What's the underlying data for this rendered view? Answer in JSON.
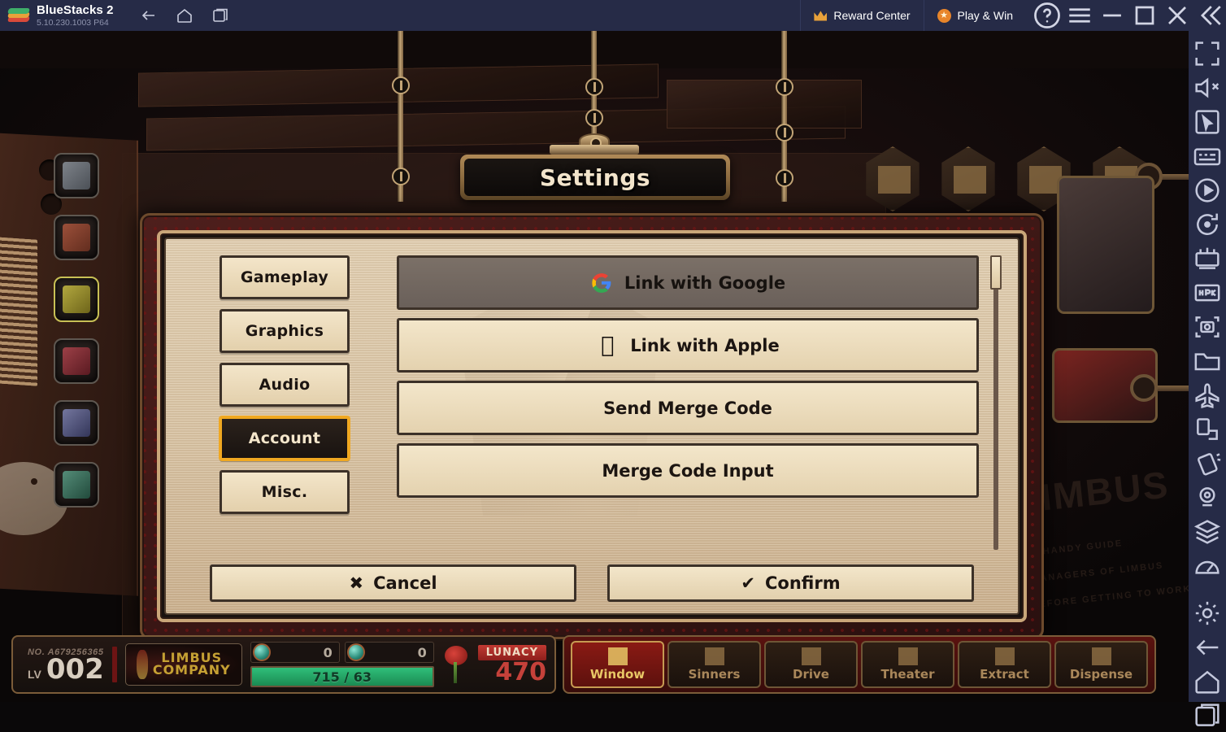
{
  "titlebar": {
    "app_name": "BlueStacks 2",
    "version": "5.10.230.1003  P64",
    "logo_icon": "bluestacks-logo-icon",
    "nav": [
      {
        "name": "back-button",
        "icon": "arrow-left-icon"
      },
      {
        "name": "home-button",
        "icon": "home-icon"
      },
      {
        "name": "recents-button",
        "icon": "multi-window-icon"
      }
    ],
    "reward_center_label": "Reward Center",
    "reward_center_icon": "crown-icon",
    "play_and_win_label": "Play & Win",
    "play_and_win_icon": "star-badge-icon",
    "sys_buttons": [
      {
        "name": "help-button",
        "icon": "question-circle-icon"
      },
      {
        "name": "menu-button",
        "icon": "hamburger-icon"
      },
      {
        "name": "minimize-button",
        "icon": "minimize-icon"
      },
      {
        "name": "maximize-button",
        "icon": "maximize-icon"
      },
      {
        "name": "close-button",
        "icon": "close-icon"
      },
      {
        "name": "collapse-sidebar-button",
        "icon": "double-chevron-left-icon"
      }
    ]
  },
  "right_toolbar": {
    "items": [
      {
        "name": "fullscreen-button",
        "icon": "fullscreen-icon"
      },
      {
        "name": "mute-button",
        "icon": "speaker-mute-icon"
      },
      {
        "name": "cursor-mode-button",
        "icon": "cursor-pointer-icon"
      },
      {
        "name": "keyboard-controls-button",
        "icon": "keyboard-icon"
      },
      {
        "name": "macro-recorder-button",
        "icon": "play-record-icon"
      },
      {
        "name": "rotate-button",
        "icon": "rotate-icon"
      },
      {
        "name": "multi-instance-button",
        "icon": "multi-instance-icon"
      },
      {
        "name": "install-apk-button",
        "icon": "apk-install-icon"
      },
      {
        "name": "screenshot-button",
        "icon": "camera-icon"
      },
      {
        "name": "media-manager-button",
        "icon": "folder-icon"
      },
      {
        "name": "eco-mode-button",
        "icon": "airplane-icon"
      },
      {
        "name": "resize-button",
        "icon": "resize-icon"
      },
      {
        "name": "shake-button",
        "icon": "shake-icon"
      },
      {
        "name": "location-button",
        "icon": "location-pin-icon"
      },
      {
        "name": "layers-button",
        "icon": "layers-icon"
      },
      {
        "name": "performance-button",
        "icon": "speedometer-icon"
      },
      {
        "name": "settings-button",
        "icon": "gear-icon"
      },
      {
        "name": "android-back-button",
        "icon": "arrow-left-icon"
      },
      {
        "name": "android-home-button",
        "icon": "home-icon"
      },
      {
        "name": "android-recents-button",
        "icon": "multi-window-icon"
      }
    ]
  },
  "dialog": {
    "title": "Settings",
    "tabs": [
      {
        "label": "Gameplay",
        "active": false
      },
      {
        "label": "Graphics",
        "active": false
      },
      {
        "label": "Audio",
        "active": false
      },
      {
        "label": "Account",
        "active": true
      },
      {
        "label": "Misc.",
        "active": false
      }
    ],
    "options": [
      {
        "label": "Link with Google",
        "icon": "google-g-icon",
        "disabled": true
      },
      {
        "label": "Link with Apple",
        "icon": "apple-logo-icon",
        "disabled": false
      },
      {
        "label": "Send Merge Code",
        "icon": "",
        "disabled": false
      },
      {
        "label": "Merge Code Input",
        "icon": "",
        "disabled": false
      }
    ],
    "cancel_label": "Cancel",
    "cancel_icon": "x-mark-icon",
    "confirm_label": "Confirm",
    "confirm_icon": "check-mark-icon",
    "scrollbar": {
      "name": "options-scrollbar",
      "thumb_position_percent": 0
    }
  },
  "hud": {
    "account_no": "NO. A679256365",
    "level_label": "LV",
    "level_value": "002",
    "company_logo_text_line1": "LIMBUS",
    "company_logo_text_line2": "COMPANY",
    "currency_1_value": "0",
    "currency_2_value": "0",
    "xp_bar_text": "715 / 63",
    "lunacy_label": "LUNACY",
    "lunacy_value": "470"
  },
  "bottom_nav": [
    {
      "label": "Window",
      "icon": "window-badge-icon",
      "active": true
    },
    {
      "label": "Sinners",
      "icon": "sinners-icon",
      "active": false
    },
    {
      "label": "Drive",
      "icon": "drive-icon",
      "active": false
    },
    {
      "label": "Theater",
      "icon": "theater-icon",
      "active": false
    },
    {
      "label": "Extract",
      "icon": "extract-icon",
      "active": false
    },
    {
      "label": "Dispense",
      "icon": "dispense-crown-icon",
      "active": false
    }
  ],
  "game_top_icons": [
    {
      "name": "announcement-icon"
    },
    {
      "name": "mail-icon"
    },
    {
      "name": "chest-icon"
    },
    {
      "name": "settings-gear-icon"
    }
  ],
  "colors": {
    "titlebar_bg": "#262b47",
    "accent_orange": "#f0a821",
    "panel_cream": "#e3d1b4",
    "dialog_maroon": "#4e1f1c",
    "frame_gold": "#c9a679",
    "lunacy_red": "#c5413a",
    "xp_green": "#2fbf7a"
  }
}
